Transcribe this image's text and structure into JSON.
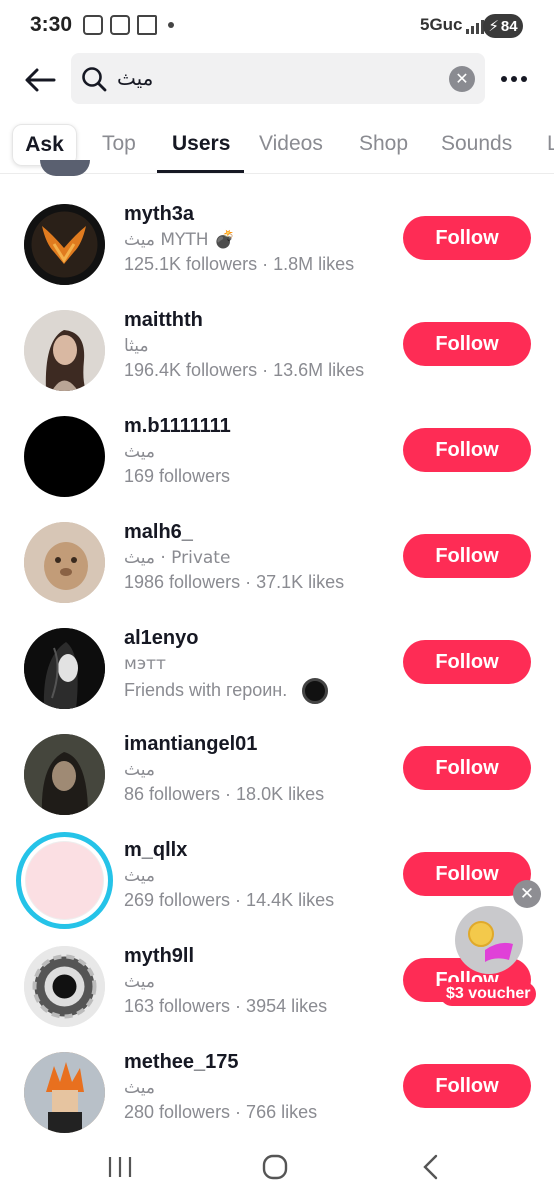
{
  "status_bar": {
    "time": "3:30",
    "network": "5Guc",
    "battery": "84"
  },
  "search": {
    "query": "ميث",
    "clear_icon": "close-icon",
    "back_icon": "back-arrow-icon",
    "more_icon": "more-dots-icon"
  },
  "tabs": [
    {
      "label": "Ask"
    },
    {
      "label": "Top"
    },
    {
      "label": "Users"
    },
    {
      "label": "Videos"
    },
    {
      "label": "Shop"
    },
    {
      "label": "Sounds"
    },
    {
      "label": "L"
    }
  ],
  "active_tab": "Users",
  "users": [
    {
      "username": "myth3a",
      "nickname": "ميث MYTH 💣",
      "stats": "125.1K followers · 1.8M likes",
      "follow_label": "Follow"
    },
    {
      "username": "maitthth",
      "nickname": "ميثا",
      "stats": "196.4K followers · 13.6M likes",
      "follow_label": "Follow"
    },
    {
      "username": "m.b1111111",
      "nickname": "ميث",
      "stats": "169 followers",
      "follow_label": "Follow"
    },
    {
      "username": "malh6_",
      "nickname": "ميث · Private",
      "stats": "1986 followers · 37.1K likes",
      "follow_label": "Follow"
    },
    {
      "username": "al1enyo",
      "nickname": "мэтт",
      "stats": "Friends with героин.",
      "follow_label": "Follow"
    },
    {
      "username": "imantiangel01",
      "nickname": "ميث",
      "stats": "86 followers · 18.0K likes",
      "follow_label": "Follow"
    },
    {
      "username": "m_qllx",
      "nickname": "ميث",
      "stats": "269 followers · 14.4K likes",
      "follow_label": "Follow"
    },
    {
      "username": "myth9ll",
      "nickname": "ميث",
      "stats": "163 followers · 3954 likes",
      "follow_label": "Follow"
    },
    {
      "username": "methee_175",
      "nickname": "ميث",
      "stats": "280 followers · 766 likes",
      "follow_label": "Follow"
    }
  ],
  "voucher": {
    "label": "$3 voucher"
  },
  "colors": {
    "accent": "#fe2c55",
    "text_primary": "#161823",
    "text_secondary": "#8a8b91"
  }
}
